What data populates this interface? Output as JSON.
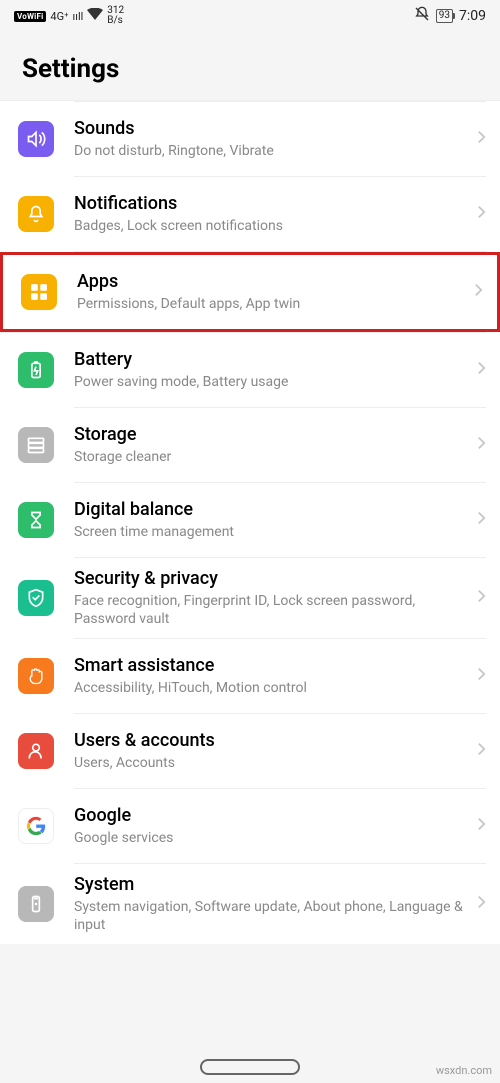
{
  "status": {
    "vowifi": "VoWiFi",
    "net": "4G⁺",
    "signal": "ııll",
    "wifi": "⌃",
    "speed_val": "312",
    "speed_unit": "B/s",
    "mute": "🔕",
    "battery": "93",
    "time": "7:09"
  },
  "header": {
    "title": "Settings"
  },
  "items": [
    {
      "title": "Sounds",
      "sub": "Do not disturb, Ringtone, Vibrate"
    },
    {
      "title": "Notifications",
      "sub": "Badges, Lock screen notifications"
    },
    {
      "title": "Apps",
      "sub": "Permissions, Default apps, App twin"
    },
    {
      "title": "Battery",
      "sub": "Power saving mode, Battery usage"
    },
    {
      "title": "Storage",
      "sub": "Storage cleaner"
    },
    {
      "title": "Digital balance",
      "sub": "Screen time management"
    },
    {
      "title": "Security & privacy",
      "sub": "Face recognition, Fingerprint ID, Lock screen password, Password vault"
    },
    {
      "title": "Smart assistance",
      "sub": "Accessibility, HiTouch, Motion control"
    },
    {
      "title": "Users & accounts",
      "sub": "Users, Accounts"
    },
    {
      "title": "Google",
      "sub": "Google services"
    },
    {
      "title": "System",
      "sub": "System navigation, Software update, About phone, Language & input"
    }
  ],
  "watermark": "wsxdn.com"
}
